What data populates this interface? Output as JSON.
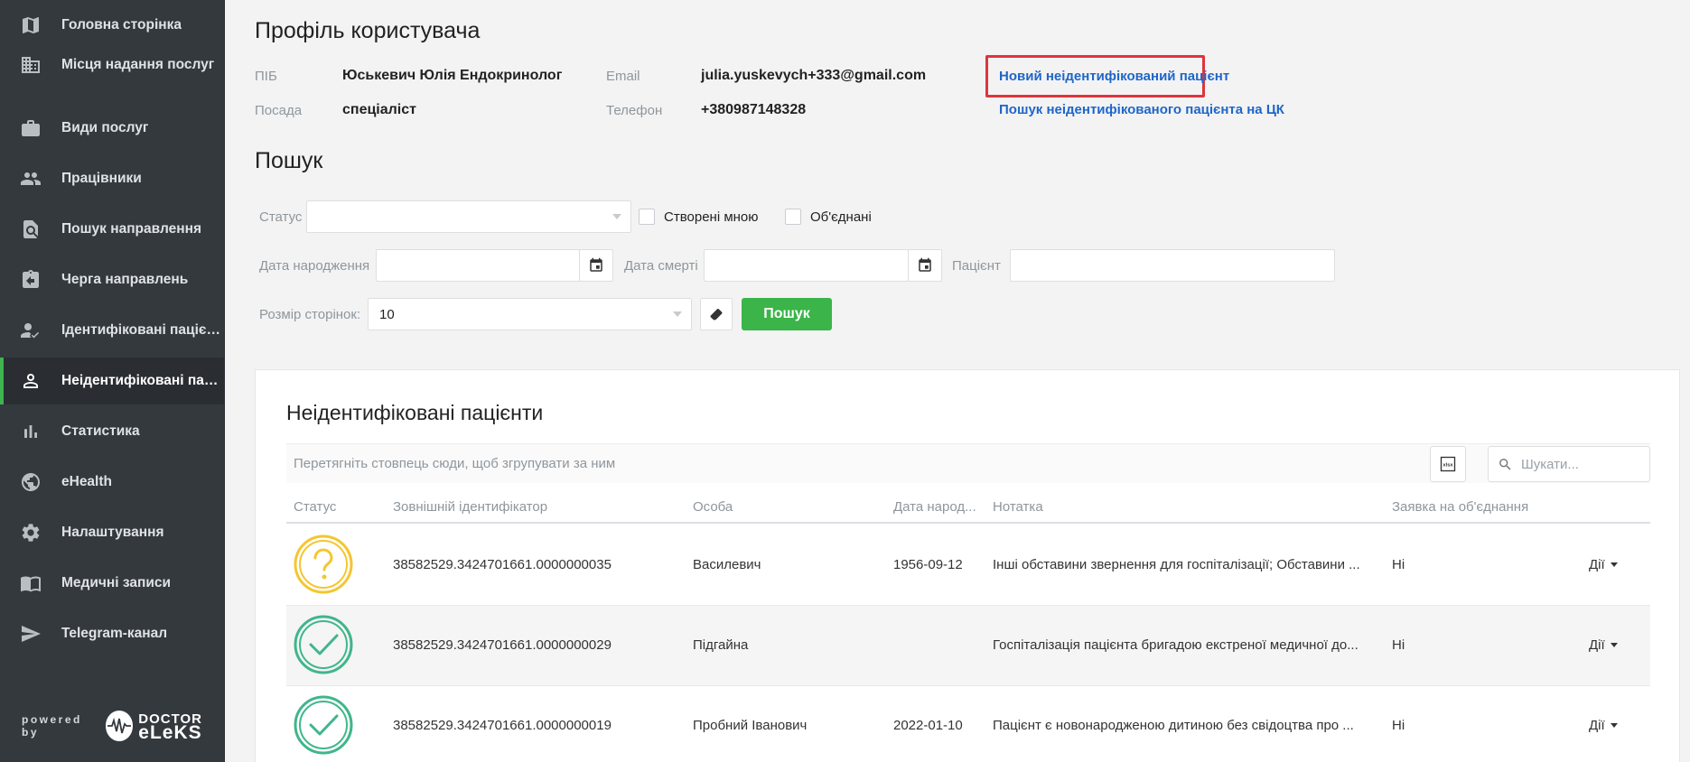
{
  "sidebar": {
    "items": [
      {
        "label": "Головна сторінка",
        "icon": "map-icon"
      },
      {
        "label": "Місця надання послуг",
        "icon": "building-icon"
      },
      {
        "label": "Види послуг",
        "icon": "briefcase-icon"
      },
      {
        "label": "Працівники",
        "icon": "people-icon"
      },
      {
        "label": "Пошук направлення",
        "icon": "search-document-icon"
      },
      {
        "label": "Черга направлень",
        "icon": "clipboard-queue-icon"
      },
      {
        "label": "Ідентифіковані пацієнти",
        "icon": "user-check-icon"
      },
      {
        "label": "Неідентифіковані пацієнти",
        "icon": "user-icon"
      },
      {
        "label": "Статистика",
        "icon": "bar-chart-icon"
      },
      {
        "label": "eHealth",
        "icon": "globe-icon"
      },
      {
        "label": "Налаштування",
        "icon": "gear-icon"
      },
      {
        "label": "Медичні записи",
        "icon": "book-icon"
      },
      {
        "label": "Telegram-канал",
        "icon": "send-icon"
      }
    ],
    "active_index": 7,
    "powered_by": "powered by",
    "brand_top": "DOCTOR",
    "brand_bottom": "eLeKS"
  },
  "profile": {
    "title": "Профіль користувача",
    "pib_label": "ПІБ",
    "pib_value": "Юськевич Юлія Ендокринолог",
    "position_label": "Посада",
    "position_value": "спеціаліст",
    "email_label": "Email",
    "email_value": "julia.yuskevych+333@gmail.com",
    "phone_label": "Телефон",
    "phone_value": "+380987148328",
    "new_patient_link": "Новий неідентифікований пацієнт",
    "search_patient_link": "Пошук неідентифікованого пацієнта на ЦК"
  },
  "search": {
    "title": "Пошук",
    "status_label": "Статус",
    "status_value": "",
    "created_by_me_label": "Створені мною",
    "merged_label": "Об'єднані",
    "birth_date_label": "Дата народження",
    "death_date_label": "Дата смерті",
    "patient_label": "Пацієнт",
    "page_size_label": "Розмір сторінок:",
    "page_size_value": "10",
    "search_button": "Пошук"
  },
  "grid": {
    "title": "Неідентифіковані пацієнти",
    "group_hint": "Перетягніть стовпець сюди, щоб згрупувати за ним",
    "search_placeholder": "Шукати...",
    "columns": [
      "Статус",
      "Зовнішній ідентифікатор",
      "Особа",
      "Дата народ...",
      "Нотатка",
      "Заявка на об'єднання"
    ],
    "actions_label": "Дії",
    "rows": [
      {
        "status": "unknown",
        "external_id": "38582529.3424701661.0000000035",
        "person": "Василевич",
        "birth_date": "1956-09-12",
        "note": "Інші обставини звернення для госпіталізації; Обставини ...",
        "merge_request": "Ні"
      },
      {
        "status": "identified",
        "external_id": "38582529.3424701661.0000000029",
        "person": "Підгайна",
        "birth_date": "",
        "note": "Госпіталізація пацієнта бригадою екстреної медичної до...",
        "merge_request": "Ні"
      },
      {
        "status": "identified",
        "external_id": "38582529.3424701661.0000000019",
        "person": "Пробний Іванович",
        "birth_date": "2022-01-10",
        "note": "Пацієнт є новонародженою дитиною без свідоцтва про ...",
        "merge_request": "Ні"
      }
    ]
  },
  "colors": {
    "sidebar_bg": "#34393e",
    "accent_green": "#3bb449",
    "link_blue": "#1e66c9",
    "highlight_red": "#e0343b",
    "status_unknown": "#f4c630",
    "status_ok": "#3fb68b"
  }
}
